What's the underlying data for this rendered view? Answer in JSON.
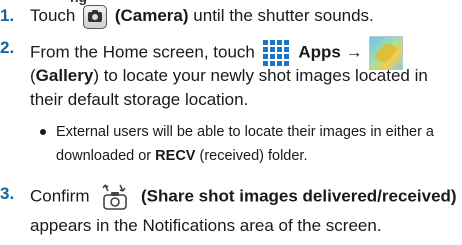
{
  "header": {
    "clipped_title": "ng"
  },
  "steps": [
    {
      "number": "1.",
      "lead": "Touch",
      "icon": "camera-icon",
      "label": "(Camera)",
      "tail": "until the shutter sounds."
    },
    {
      "number": "2.",
      "lead": "From the Home screen, touch",
      "apps_icon": "apps-grid-icon",
      "apps_label": "Apps",
      "arrow": "→",
      "gallery_icon": "gallery-icon",
      "line2": "(Gallery) to locate your newly shot images located in",
      "line3": "their default storage location.",
      "bullet": {
        "line1": "External users will be able to locate their images in either a",
        "line2_pre": "downloaded or",
        "line2_bold": "RECV",
        "line2_post": "(received) folder."
      }
    },
    {
      "number": "3.",
      "lead": "Confirm",
      "icon": "share-images-icon",
      "label": "(Share shot images delivered/received)",
      "line2": "appears in the Notifications area of the screen."
    }
  ],
  "colors": {
    "step_number": "#17639b",
    "apps_blue": "#1976c8"
  }
}
